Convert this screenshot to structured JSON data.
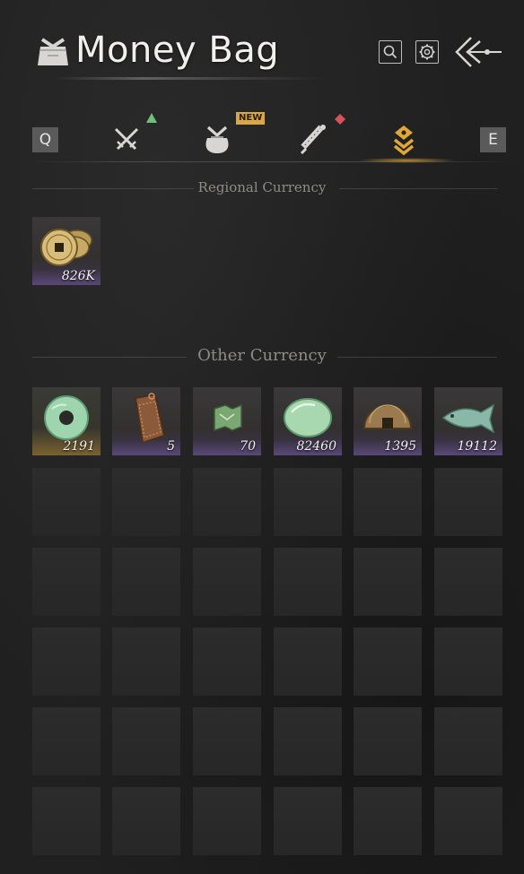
{
  "header": {
    "title": "Money Bag",
    "icons": [
      "money-bag-icon",
      "search-icon",
      "gear-icon",
      "back-arrow-icon"
    ]
  },
  "tabs": {
    "left_key": "Q",
    "right_key": "E",
    "items": [
      {
        "name": "weapons",
        "icon": "crossed-swords-icon",
        "indicator": "green-triangle"
      },
      {
        "name": "bag",
        "icon": "bag-icon",
        "badge": "NEW"
      },
      {
        "name": "scrolls",
        "icon": "scroll-icon",
        "indicator": "red-diamond"
      },
      {
        "name": "money",
        "icon": "coin-stack-icon",
        "active": true
      }
    ]
  },
  "regional": {
    "title": "Regional Currency",
    "items": [
      {
        "icon": "copper-coins-icon",
        "quantity": "826K"
      }
    ]
  },
  "other": {
    "title": "Other Currency",
    "items": [
      {
        "icon": "jade-ring-icon",
        "quantity": "2191"
      },
      {
        "icon": "bronze-token-icon",
        "quantity": "5"
      },
      {
        "icon": "green-map-icon",
        "quantity": "70"
      },
      {
        "icon": "jade-stone-icon",
        "quantity": "82460"
      },
      {
        "icon": "bronze-half-coin-icon",
        "quantity": "1395"
      },
      {
        "icon": "jade-fish-icon",
        "quantity": "19112"
      }
    ]
  },
  "colors": {
    "active_tab": "#e0a838",
    "new_badge": "#d8a848",
    "rarity_gold": "#7a6230",
    "rarity_purple": "#6e5a96"
  }
}
